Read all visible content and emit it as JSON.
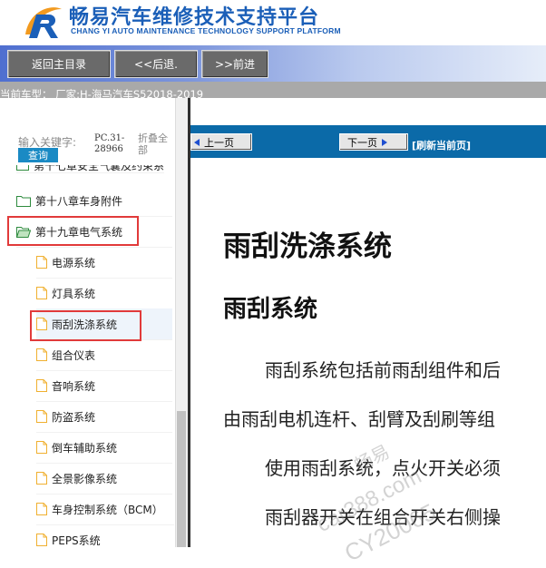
{
  "header": {
    "title_cn": "畅易汽车维修技术支持平台",
    "title_en": "CHANG YI AUTO MAINTENANCE TECHNOLOGY SUPPORT PLATFORM"
  },
  "toolbar": {
    "home_label": "返回主目录",
    "back_label": "<<后退.",
    "forward_label": ">>前进"
  },
  "car_info": "当前车型： 厂家:H-海马汽车S52018-2019",
  "search": {
    "label": "输入关键字:",
    "value": "PC.31-28966",
    "query_label": "查询",
    "expand_label": "折叠全部"
  },
  "tree": {
    "partial_top": "第十七章安全气囊及约束系",
    "items": [
      {
        "label": "第十八章车身附件",
        "level": 0,
        "type": "folder"
      },
      {
        "label": "第十九章电气系统",
        "level": 0,
        "type": "folder-open"
      },
      {
        "label": "电源系统",
        "level": 1,
        "type": "doc"
      },
      {
        "label": "灯具系统",
        "level": 1,
        "type": "doc"
      },
      {
        "label": "雨刮洗涤系统",
        "level": 1,
        "type": "doc"
      },
      {
        "label": "组合仪表",
        "level": 1,
        "type": "doc"
      },
      {
        "label": "音响系统",
        "level": 1,
        "type": "doc"
      },
      {
        "label": "防盗系统",
        "level": 1,
        "type": "doc"
      },
      {
        "label": "倒车辅助系统",
        "level": 1,
        "type": "doc"
      },
      {
        "label": "全景影像系统",
        "level": 1,
        "type": "doc"
      },
      {
        "label": "车身控制系统（BCM）",
        "level": 1,
        "type": "doc"
      },
      {
        "label": "PEPS系统",
        "level": 1,
        "type": "doc"
      }
    ]
  },
  "nav": {
    "prev_label": "上一页",
    "next_label": "下一页",
    "refresh_label": "[刷新当前页]"
  },
  "doc": {
    "h1": "雨刮洗涤系统",
    "h2": "雨刮系统",
    "p1": "雨刮系统包括前雨刮组件和后",
    "p2": "由雨刮电机连杆、刮臂及刮刷等组",
    "p3": "使用雨刮系统，点火开关必须",
    "p4": "雨刮器开关在组合开关右侧操"
  },
  "watermark": {
    "line1": "畅易",
    "line2": "car388.com",
    "line3": "CY20065"
  },
  "colors": {
    "brand_blue": "#1b5fb8",
    "nav_blue": "#0b6aa8",
    "highlight_red": "#e13a3a",
    "folder_green": "#2e8b3e",
    "doc_icon": "#f0b030"
  }
}
